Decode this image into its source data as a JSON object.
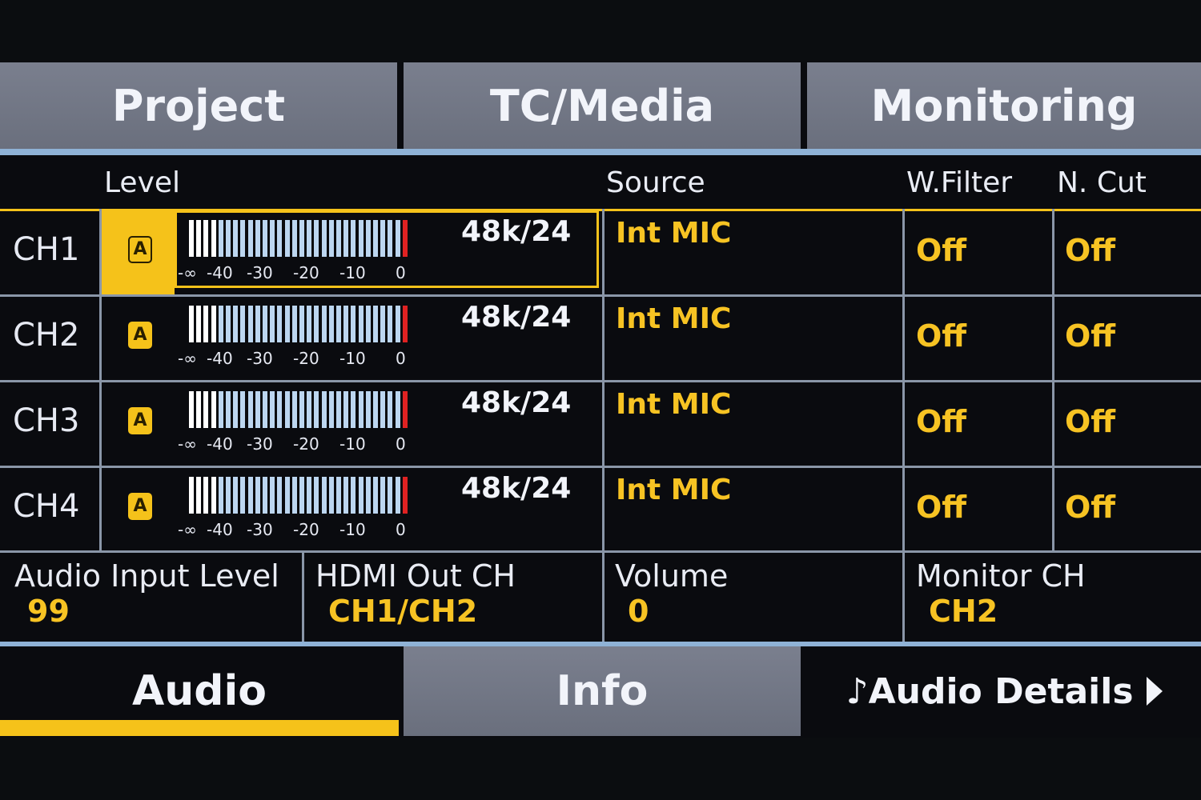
{
  "top_tabs": [
    "Project",
    "TC/Media",
    "Monitoring"
  ],
  "headers": {
    "level": "Level",
    "source": "Source",
    "wfilter": "W.Filter",
    "ncut": "N. Cut"
  },
  "scale_labels": [
    "-∞",
    "-40",
    "-30",
    "-20",
    "-10",
    "0"
  ],
  "channels": [
    {
      "label": "CH1",
      "mode_badge": "A",
      "rate": "48k/24",
      "source": "Int MIC",
      "wfilter": "Off",
      "ncut": "Off"
    },
    {
      "label": "CH2",
      "mode_badge": "A",
      "rate": "48k/24",
      "source": "Int MIC",
      "wfilter": "Off",
      "ncut": "Off"
    },
    {
      "label": "CH3",
      "mode_badge": "A",
      "rate": "48k/24",
      "source": "Int MIC",
      "wfilter": "Off",
      "ncut": "Off"
    },
    {
      "label": "CH4",
      "mode_badge": "A",
      "rate": "48k/24",
      "source": "Int MIC",
      "wfilter": "Off",
      "ncut": "Off"
    }
  ],
  "settings": {
    "audio_input_level": {
      "label": "Audio Input Level",
      "value": "99"
    },
    "hdmi_out_ch": {
      "label": "HDMI Out CH",
      "value": "CH1/CH2"
    },
    "volume": {
      "label": "Volume",
      "value": "0"
    },
    "monitor_ch": {
      "label": "Monitor CH",
      "value": "CH2"
    }
  },
  "bottom_tabs": {
    "audio": "Audio",
    "info": "Info",
    "details": "♪Audio Details"
  },
  "colors": {
    "accent": "#f5c21a",
    "tab_bg": "#737888",
    "divider": "#8fb2d6",
    "meter": "#bcd6f0",
    "peak": "#e02222"
  }
}
